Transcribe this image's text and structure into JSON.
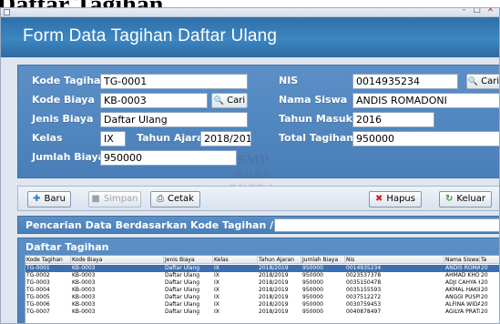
{
  "page_heading": "Daftar Tagihan",
  "window": {
    "minimize_glyph": "–",
    "maximize_glyph": "□",
    "close_glyph": "✕"
  },
  "form_title": "Form Data Tagihan Daftar Ulang",
  "form": {
    "kode_tagihan": {
      "label": "Kode Tagihan",
      "value": "TG-0001"
    },
    "kode_biaya": {
      "label": "Kode Biaya",
      "value": "KB-0003",
      "button": "Cari"
    },
    "jenis_biaya": {
      "label": "Jenis Biaya",
      "value": "Daftar Ulang"
    },
    "kelas": {
      "label": "Kelas",
      "value": "IX"
    },
    "tahun_ajaran": {
      "label": "Tahun Ajaran",
      "value": "2018/2019"
    },
    "jumlah_biaya": {
      "label": "Jumlah Biaya",
      "value": "950000"
    },
    "nis": {
      "label": "NIS",
      "value": "0014935234",
      "button": "Cari"
    },
    "nama_siswa": {
      "label": "Nama Siswa",
      "value": "ANDIS ROMADONI"
    },
    "tahun_masuk": {
      "label": "Tahun Masuk",
      "value": "2016"
    },
    "total_tagihan": {
      "label": "Total Tagihan",
      "value": "950000"
    }
  },
  "watermark": {
    "line1": "SMP",
    "line2": "NUSA PUTRA"
  },
  "actions": {
    "baru": "Baru",
    "simpan": "Simpan",
    "cetak": "Cetak",
    "hapus": "Hapus",
    "keluar": "Keluar"
  },
  "search": {
    "label": "Pencarian Data Berdasarkan Kode Tagihan / Nama Siswa",
    "value": ""
  },
  "table": {
    "title": "Daftar Tagihan",
    "columns": [
      "Kode Tagihan",
      "Kode Biaya",
      "Jenis Biaya",
      "Kelas",
      "Tahun Ajaran",
      "Jumlah Biaya",
      "Nis",
      "Nama Siswa",
      "Ta"
    ],
    "rows": [
      [
        "TG-0001",
        "KB-0003",
        "Daftar Ulang",
        "IX",
        "2018/2019",
        "950000",
        "0014935234",
        "ANDIS ROMA...",
        "20"
      ],
      [
        "TG-0002",
        "KB-0003",
        "Daftar Ulang",
        "IX",
        "2018/2019",
        "950000",
        "0023537378",
        "AHMAD KHOI...",
        "20"
      ],
      [
        "TG-0003",
        "KB-0003",
        "Daftar Ulang",
        "IX",
        "2018/2019",
        "950000",
        "0035150478",
        "ADJI CAHYA K...",
        "20"
      ],
      [
        "TG-0004",
        "KB-0003",
        "Daftar Ulang",
        "IX",
        "2018/2019",
        "950000",
        "0035155593",
        "AKMAL HAKIM",
        "20"
      ],
      [
        "TG-0005",
        "KB-0003",
        "Daftar Ulang",
        "IX",
        "2018/2019",
        "950000",
        "0037512272",
        "ANGGI PUSPI...",
        "20"
      ],
      [
        "TG-0006",
        "KB-0003",
        "Daftar Ulang",
        "IX",
        "2018/2019",
        "950000",
        "0030759453",
        "ALFINA WIDAY...",
        "20"
      ],
      [
        "TG-0007",
        "KB-0003",
        "Daftar Ulang",
        "IX",
        "2018/2019",
        "950000",
        "0040878497",
        "AGILYA PRATI...",
        "20"
      ]
    ]
  },
  "colors": {
    "header": "#3d86c2",
    "panel": "#4a7eb8",
    "selected_row": "#3c6fb1",
    "background": "#dfe6ef"
  }
}
